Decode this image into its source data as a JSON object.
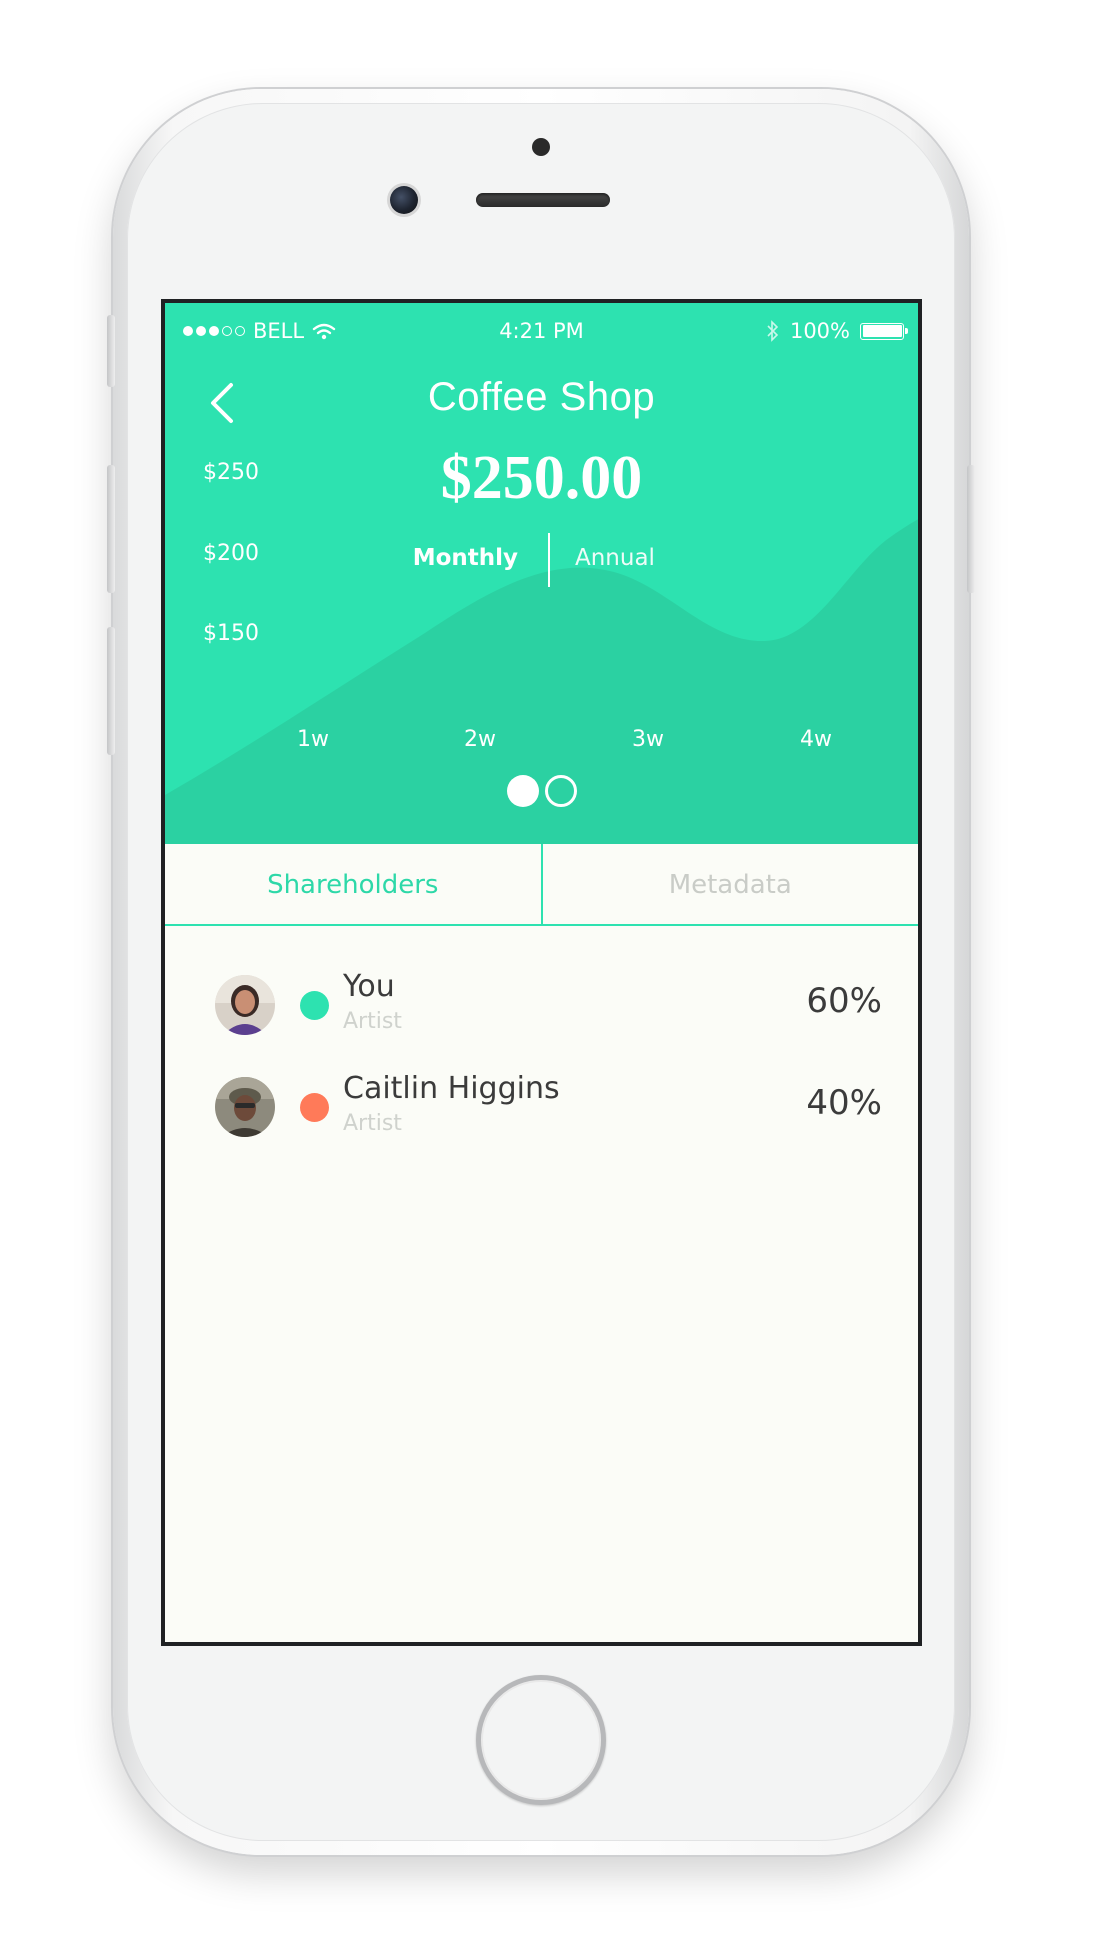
{
  "status_bar": {
    "carrier": "BELL",
    "time": "4:21 PM",
    "battery": "100%"
  },
  "header": {
    "title": "Coffee Shop",
    "amount": "$250.00",
    "periods": {
      "monthly": "Monthly",
      "annual": "Annual"
    },
    "active_period": "monthly"
  },
  "chart_data": {
    "type": "area",
    "y_ticks": [
      "$250",
      "$200",
      "$150"
    ],
    "x_ticks": [
      "1w",
      "2w",
      "3w",
      "4w"
    ],
    "color": "#2bd1a2"
  },
  "pager": {
    "pages": 2,
    "active": 0
  },
  "tabs": [
    {
      "label": "Shareholders",
      "active": true
    },
    {
      "label": "Metadata",
      "active": false
    }
  ],
  "shareholders": [
    {
      "name": "You",
      "role": "Artist",
      "percent": "60%",
      "color": "#2de2b0"
    },
    {
      "name": "Caitlin Higgins",
      "role": "Artist",
      "percent": "40%",
      "color": "#ff7a59"
    }
  ],
  "colors": {
    "accent": "#2de2b0",
    "background": "#fbfcf7"
  }
}
